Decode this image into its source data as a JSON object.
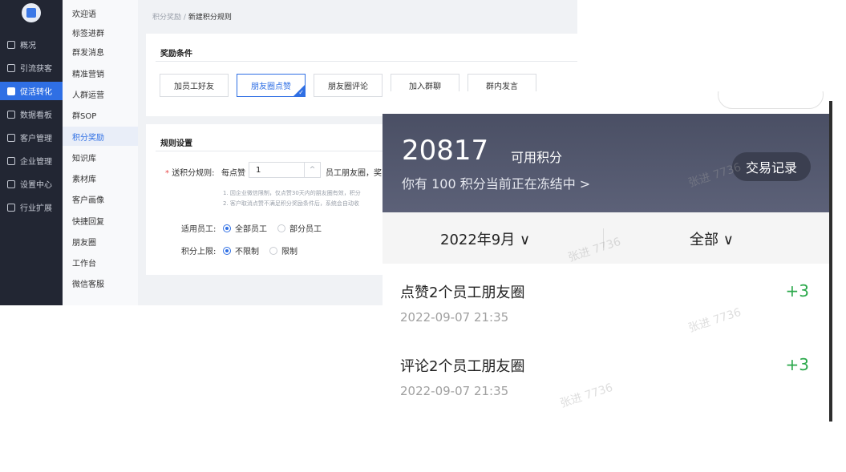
{
  "sidebar": {
    "items": [
      {
        "label": "概况",
        "icon": "chat-icon"
      },
      {
        "label": "引流获客",
        "icon": "layout-icon"
      },
      {
        "label": "促活转化",
        "icon": "doc-icon",
        "active": true
      },
      {
        "label": "数据看板",
        "icon": "bar-chart-icon"
      },
      {
        "label": "客户管理",
        "icon": "user-icon"
      },
      {
        "label": "企业管理",
        "icon": "building-icon"
      },
      {
        "label": "设置中心",
        "icon": "gear-icon"
      },
      {
        "label": "行业扩展",
        "icon": "branch-icon"
      }
    ]
  },
  "submenu": {
    "items": [
      "欢迎语",
      "标签进群",
      "群发消息",
      "精准营销",
      "人群运营",
      "群SOP",
      "积分奖励",
      "知识库",
      "素材库",
      "客户画像",
      "快捷回复",
      "朋友圈",
      "工作台",
      "微信客服"
    ],
    "active_index": 6
  },
  "breadcrumb": {
    "parent": "积分奖励",
    "sep": "/",
    "current": "新建积分规则"
  },
  "reward_card": {
    "title": "奖励条件",
    "tabs": [
      "加员工好友",
      "朋友圈点赞",
      "朋友圈评论",
      "加入群聊",
      "群内发言"
    ],
    "active_tab": 1
  },
  "rules_card": {
    "title": "规则设置",
    "rule_label": "送积分规则:",
    "required_mark": "*",
    "each_like": "每点赞",
    "input_value": "1",
    "after_input": "员工朋友圈，奖",
    "note1": "1. 因企业微信限制，仅点赞30天内的朋友圈有效，积分",
    "note2": "2. 客户取消点赞不满足积分奖励条件后，系统会自动收",
    "staff_label": "适用员工:",
    "staff_options": [
      "全部员工",
      "部分员工"
    ],
    "staff_selected": 0,
    "limit_label": "积分上限:",
    "limit_options": [
      "不限制",
      "限制"
    ],
    "limit_selected": 0
  },
  "phone": {
    "points": "20817",
    "points_label": "可用积分",
    "frozen_text": "你有 100 积分当前正在冻结中 >",
    "trade_button": "交易记录",
    "month_filter": "2022年9月 ∨",
    "type_filter": "全部 ∨",
    "watermark": "张进 7736",
    "records": [
      {
        "title": "点赞2个员工朋友圈",
        "time": "2022-09-07  21:35",
        "delta": "+3"
      },
      {
        "title": "评论2个员工朋友圈",
        "time": "2022-09-07  21:35",
        "delta": "+3"
      }
    ]
  },
  "colors": {
    "sidebar_bg": "#222633",
    "accent": "#2f6fe4",
    "positive": "#2aa84a",
    "phone_header": "#4a4f64"
  }
}
